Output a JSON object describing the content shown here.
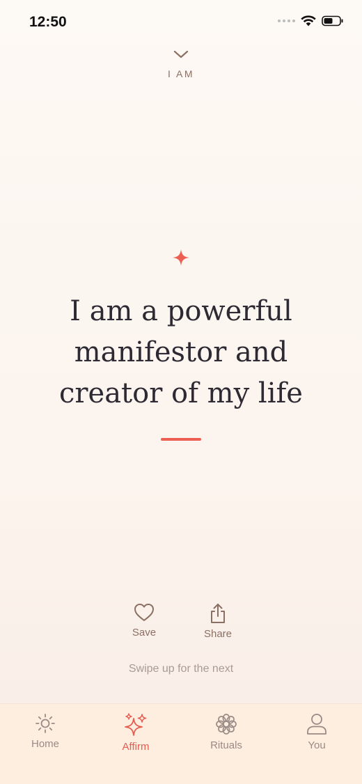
{
  "status": {
    "time": "12:50"
  },
  "header": {
    "collapse_icon": "chevron-down-icon",
    "category": "I AM"
  },
  "affirmation": {
    "icon": "sparkle-icon",
    "lines": [
      "I am a powerful",
      "manifestor and",
      "creator of my life"
    ],
    "accent_color": "#ec5f52"
  },
  "actions": {
    "save_label": "Save",
    "share_label": "Share"
  },
  "hint": "Swipe up for the next",
  "tabbar": {
    "items": [
      {
        "label": "Home",
        "icon": "sun-icon",
        "active": false
      },
      {
        "label": "Affirm",
        "icon": "sparkles-icon",
        "active": true
      },
      {
        "label": "Rituals",
        "icon": "flower-icon",
        "active": false
      },
      {
        "label": "You",
        "icon": "user-icon",
        "active": false
      }
    ],
    "active_color": "#e55d4f",
    "inactive_color": "#9a8a85"
  }
}
